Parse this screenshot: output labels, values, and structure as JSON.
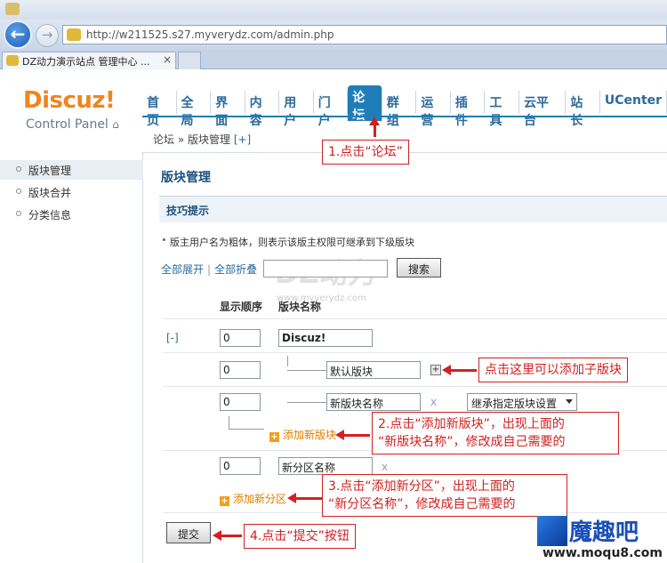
{
  "browser": {
    "window_title": "",
    "url": "http://w211525.s27.myverydz.com/admin.php",
    "tab_title": "DZ动力演示站点 管理中心 ...",
    "tab_close": "×"
  },
  "header": {
    "logo": "Discuz!",
    "logo_sub": "Control Panel",
    "nav": [
      "首页",
      "全局",
      "界面",
      "内容",
      "用户",
      "门户",
      "论坛",
      "群组",
      "运营",
      "插件",
      "工具",
      "云平台",
      "站长",
      "UCenter"
    ],
    "active_nav": "论坛",
    "breadcrumb": "论坛 » 版块管理",
    "breadcrumb_add": "[+]"
  },
  "sidebar": {
    "items": [
      {
        "label": "版块管理"
      },
      {
        "label": "版块合并"
      },
      {
        "label": "分类信息"
      }
    ]
  },
  "main": {
    "title": "版块管理",
    "tips_title": "技巧提示",
    "tip": "版主用户名为粗体，则表示该版主权限可继承到下级版块",
    "expand_all": "全部展开",
    "sep": "|",
    "collapse_all": "全部折叠",
    "search_button": "搜索",
    "watermark": "DZ动力",
    "watermark_url": "www.myverydz.com",
    "col_order": "显示顺序",
    "col_name": "版块名称",
    "collapse_toggle": "[-]",
    "rows": [
      {
        "order": "0",
        "name": "Discuz!"
      },
      {
        "order": "0",
        "name": "默认版块"
      },
      {
        "order": "0",
        "name": "新版块名称",
        "select": "继承指定版块设置"
      },
      {
        "order": "0",
        "name": "新分区名称"
      }
    ],
    "add_forum": "添加新版块",
    "add_category": "添加新分区",
    "submit": "提交",
    "delete_x": "x"
  },
  "annotations": {
    "step1": "1.点击“论坛”",
    "sub_hint": "点击这里可以添加子版块",
    "step2_l1": "2.点击“添加新版块”，出现上面的",
    "step2_l2": "“新版块名称”，修改成自己需要的",
    "step3_l1": "3.点击“添加新分区”，出现上面的",
    "step3_l2": "“新分区名称”，修改成自己需要的",
    "step4": "4.点击“提交”按钮"
  },
  "brand": {
    "name": "魔趣吧",
    "site": "www.moqu8.com",
    "site_small": "MOQU8.COM"
  },
  "colors": {
    "accent": "#1f7db8",
    "logo": "#f1851d",
    "annotation": "#d02020"
  }
}
